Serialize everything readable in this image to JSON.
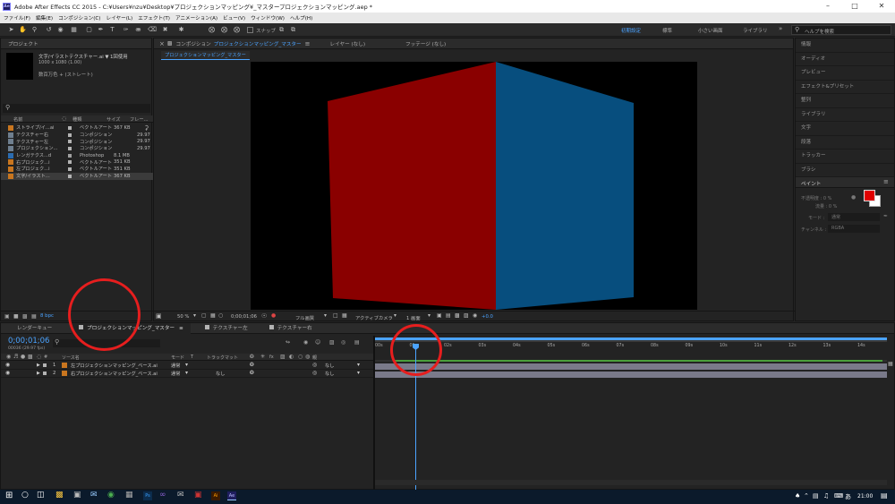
{
  "window": {
    "title": "Adobe After Effects CC 2015 - C:¥Users¥nzu¥Desktop¥プロジェクションマッピング¥_マスタープロジェクションマッピング.aep *",
    "app_icon": "Ae"
  },
  "menu": [
    "ファイル(F)",
    "編集(E)",
    "コンポジション(C)",
    "レイヤー(L)",
    "エフェクト(T)",
    "アニメーション(A)",
    "ビュー(V)",
    "ウィンドウ(W)",
    "ヘルプ(H)"
  ],
  "toolbar": {
    "snap_label": "スナップ",
    "workspaces": [
      "初期設定",
      "標準",
      "小さい画面",
      "ライブラリ"
    ],
    "search_placeholder": "ヘルプを検索"
  },
  "project": {
    "tab": "プロジェクト",
    "selected_name": "文字/イラストテクスチャー.ai ▼",
    "selected_usage": "1回使用",
    "selected_size": "1000 x 1080 (1.00)",
    "selected_color": "数百万色 + (ストレート)",
    "columns": {
      "name": "名前",
      "type": "種類",
      "size": "サイズ",
      "frame": "フレー..."
    },
    "items": [
      {
        "name": "ストライプ/イ...ai",
        "type": "ベクトルアート",
        "size": "367 KB",
        "fps": "",
        "color": "#b3b3b3",
        "icon": "ai"
      },
      {
        "name": "テクスチャー右",
        "type": "コンポジション",
        "size": "",
        "fps": "29.97",
        "color": "#b3b3b3",
        "icon": "comp"
      },
      {
        "name": "テクスチャー左",
        "type": "コンポジション",
        "size": "",
        "fps": "29.97",
        "color": "#b3b3b3",
        "icon": "comp"
      },
      {
        "name": "プロジェクション...",
        "type": "コンポジション",
        "size": "",
        "fps": "29.97",
        "color": "#b3b3b3",
        "icon": "comp"
      },
      {
        "name": "レンガテクス...d",
        "type": "Photoshop",
        "size": "8.1 MB",
        "fps": "",
        "color": "#a0a0a0",
        "icon": "psd"
      },
      {
        "name": "右プロジェク...i",
        "type": "ベクトルアート",
        "size": "351 KB",
        "fps": "",
        "color": "#b3b3b3",
        "icon": "ai"
      },
      {
        "name": "左プロジェク...i",
        "type": "ベクトルアート",
        "size": "351 KB",
        "fps": "",
        "color": "#b3b3b3",
        "icon": "ai"
      },
      {
        "name": "文字/イラスト...",
        "type": "ベクトルアート",
        "size": "367 KB",
        "fps": "",
        "color": "#b3b3b3",
        "icon": "ai"
      }
    ],
    "bpc": "8 bpc"
  },
  "composition": {
    "tab_prefix": "コンポジション",
    "tab_name": "プロジェクションマッピング_マスター",
    "layer_tab": "レイヤー (なし)",
    "footage_tab": "フッテージ (なし)",
    "breadcrumb": "プロジェクションマッピング_マスター",
    "zoom": "50 %",
    "timecode": "0;00;01;06",
    "resolution": "フル画質",
    "camera": "アクティブカメラ",
    "views": "1 画面",
    "offset": "+0.0",
    "left_face_color": "#8a0000",
    "right_face_color": "#074e7e"
  },
  "right_panel": {
    "items": [
      "情報",
      "オーディオ",
      "プレビュー",
      "エフェクト&プリセット",
      "整列",
      "ライブラリ",
      "文字",
      "段落",
      "トラッカー",
      "ブラシ"
    ],
    "paint": {
      "title": "ペイント",
      "opacity_label": "不透明度 : 0 %",
      "flow_label": "流量 : 0 %",
      "mode_label": "モード :",
      "mode_value": "通常",
      "channel_label": "チャンネル :",
      "channel_value": "RGBA",
      "fg_color": "#e00000"
    }
  },
  "timeline": {
    "tabs": [
      "レンダーキュー",
      "プロジェクションマッピング_マスター",
      "テクスチャー左",
      "テクスチャー右"
    ],
    "timecode": "0;00;01;06",
    "fps_info": "00036 (29.97 fps)",
    "col_source": "ソース名",
    "col_mode": "モード",
    "col_trkmat": "トラックマット",
    "col_parent": "親",
    "layers": [
      {
        "num": "1",
        "name": "左プロジェクションマッピング_ベース.ai",
        "mode": "通常",
        "trkmat": "",
        "parent": "なし",
        "color": "#b3b3b3"
      },
      {
        "num": "2",
        "name": "右プロジェクションマッピング_ベース.ai",
        "mode": "通常",
        "trkmat": "なし",
        "parent": "なし",
        "color": "#b3b3b3"
      }
    ],
    "ruler": [
      "00s",
      "01s",
      "02s",
      "03s",
      "04s",
      "05s",
      "06s",
      "07s",
      "08s",
      "09s",
      "10s",
      "11s",
      "12s",
      "13s",
      "14s"
    ]
  },
  "taskbar": {
    "time": "21:00",
    "ime": "あ"
  }
}
